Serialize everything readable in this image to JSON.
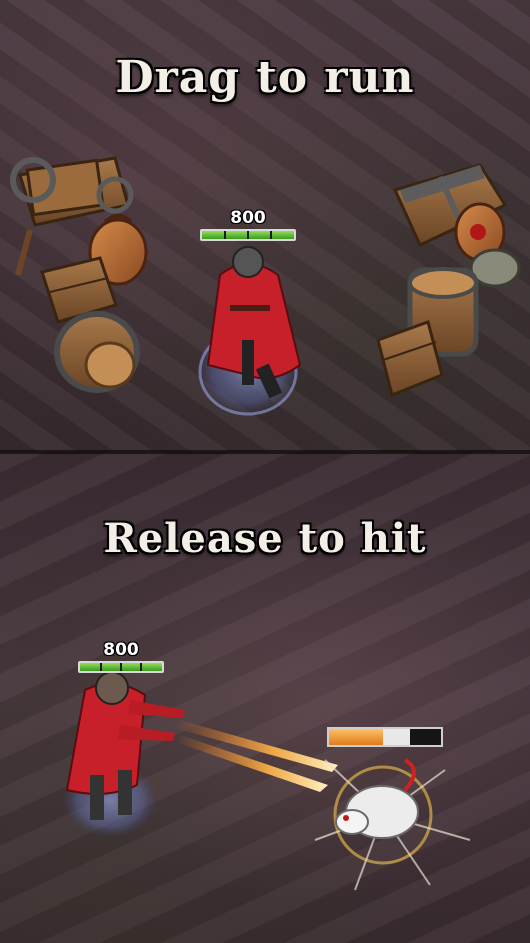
{
  "top_panel": {
    "headline": "Drag to run",
    "player_hp": {
      "value": "800",
      "fill": 1.0
    }
  },
  "bottom_panel": {
    "headline": "Release to hit",
    "player_hp": {
      "value": "800",
      "fill": 1.0
    },
    "enemy_hp": {
      "fill": 0.48,
      "damage_preview": 0.24
    }
  },
  "colors": {
    "cloak_red": "#c8202a",
    "hp_green": "#5cc232",
    "enemy_orange": "#f0952c",
    "shot_orange": "#ffb347"
  },
  "icons": [
    "crate-icon",
    "barrel-icon",
    "sack-icon",
    "cart-icon",
    "chest-icon",
    "rat-enemy-icon",
    "hunter-player-icon"
  ]
}
